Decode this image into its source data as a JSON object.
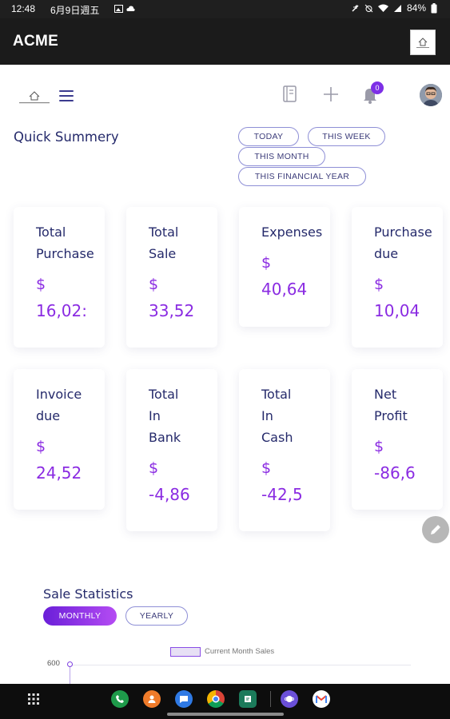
{
  "status_bar": {
    "time": "12:48",
    "date": "6月9日週五",
    "battery": "84%"
  },
  "app_bar": {
    "title": "ACME",
    "logo_icon": "company-logo-icon"
  },
  "header": {
    "notification_count": "0",
    "icons": [
      "site-logo-icon",
      "hamburger-icon",
      "notebook-icon",
      "plus-icon",
      "bell-icon",
      "avatar"
    ]
  },
  "quick_summary": {
    "title": "Quick Summery",
    "filters": [
      "TODAY",
      "THIS WEEK",
      "THIS MONTH",
      "THIS FINANCIAL YEAR"
    ],
    "cards": [
      {
        "label": "Total\nPurchase",
        "currency": "$",
        "value": "16,02:"
      },
      {
        "label": "Total\nSale",
        "currency": "$",
        "value": "33,52"
      },
      {
        "label": "Expenses",
        "currency": "$",
        "value": "40,64"
      },
      {
        "label": "Purchase\ndue",
        "currency": "$",
        "value": "10,04"
      },
      {
        "label": "Invoice\ndue",
        "currency": "$",
        "value": "24,52"
      },
      {
        "label": "Total\nIn\nBank",
        "currency": "$",
        "value": "-4,86"
      },
      {
        "label": "Total\nIn\nCash",
        "currency": "$",
        "value": "-42,5"
      },
      {
        "label": "Net\nProfit",
        "currency": "$",
        "value": "-86,6"
      }
    ]
  },
  "sale_statistics": {
    "title": "Sale Statistics",
    "tabs": [
      "MONTHLY",
      "YEARLY"
    ],
    "active_tab": "MONTHLY",
    "legend": "Current Month Sales",
    "y_tick": "600"
  },
  "colors": {
    "accent": "#8a2be2",
    "heading": "#252a6b",
    "appbar": "#1b1b1b"
  },
  "taskbar": {
    "apps": [
      "apps-grid-icon",
      "phone-app-icon",
      "contacts-app-icon",
      "messages-app-icon",
      "chrome-app-icon",
      "notes-app-icon",
      "browser-app-icon",
      "gmail-app-icon"
    ]
  }
}
